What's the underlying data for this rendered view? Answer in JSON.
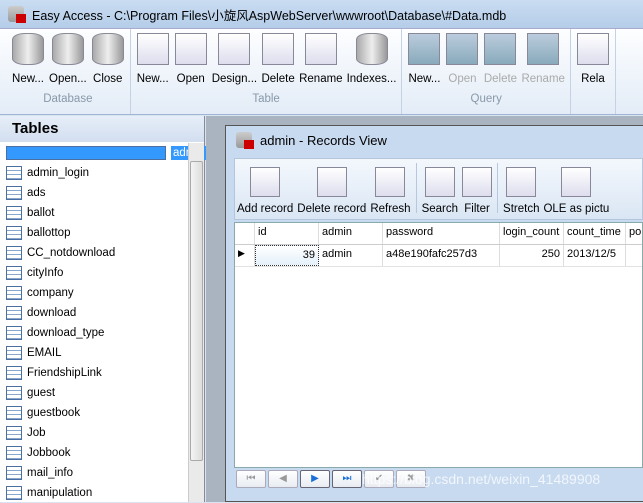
{
  "window": {
    "title": "Easy Access - C:\\Program Files\\小旋风AspWebServer\\wwwroot\\Database\\#Data.mdb"
  },
  "ribbon": {
    "groups": [
      {
        "label": "Database",
        "buttons": [
          {
            "label": "New...",
            "icon": "new-database-icon"
          },
          {
            "label": "Open...",
            "icon": "open-database-icon"
          },
          {
            "label": "Close",
            "icon": "close-database-icon"
          }
        ]
      },
      {
        "label": "Table",
        "buttons": [
          {
            "label": "New...",
            "icon": "new-table-icon"
          },
          {
            "label": "Open",
            "icon": "open-table-icon"
          },
          {
            "label": "Design...",
            "icon": "design-table-icon"
          },
          {
            "label": "Delete",
            "icon": "delete-table-icon"
          },
          {
            "label": "Rename",
            "icon": "rename-icon"
          },
          {
            "label": "Indexes...",
            "icon": "indexes-icon"
          }
        ]
      },
      {
        "label": "Query",
        "buttons": [
          {
            "label": "New...",
            "icon": "new-query-icon",
            "disabled": false
          },
          {
            "label": "Open",
            "icon": "open-query-icon",
            "disabled": true
          },
          {
            "label": "Delete",
            "icon": "delete-query-icon",
            "disabled": true
          },
          {
            "label": "Rename",
            "icon": "rename-query-icon",
            "disabled": true
          }
        ]
      },
      {
        "label": "",
        "buttons": [
          {
            "label": "Rela",
            "icon": "relations-icon"
          }
        ]
      }
    ]
  },
  "tables": {
    "title": "Tables",
    "selected": "admin",
    "items": [
      "admin",
      "admin_login",
      "ads",
      "ballot",
      "ballottop",
      "CC_notdownload",
      "cityInfo",
      "company",
      "download",
      "download_type",
      "EMAIL",
      "FriendshipLink",
      "guest",
      "guestbook",
      "Job",
      "Jobbook",
      "mail_info",
      "manipulation"
    ]
  },
  "records": {
    "title": "admin - Records View",
    "toolbar": [
      "Add record",
      "Delete record",
      "Refresh",
      "Search",
      "Filter",
      "Stretch",
      "OLE as pictu"
    ],
    "columns": [
      "id",
      "admin",
      "password",
      "login_count",
      "count_time",
      "po"
    ],
    "rows": [
      [
        "39",
        "admin",
        "a48e190fafc257d3",
        "250",
        "2013/12/5",
        ""
      ]
    ],
    "nav": [
      "⏮",
      "◀",
      "▶",
      "⏭",
      "✔",
      "✖"
    ]
  },
  "watermark": "https://blog.csdn.net/weixin_41489908"
}
